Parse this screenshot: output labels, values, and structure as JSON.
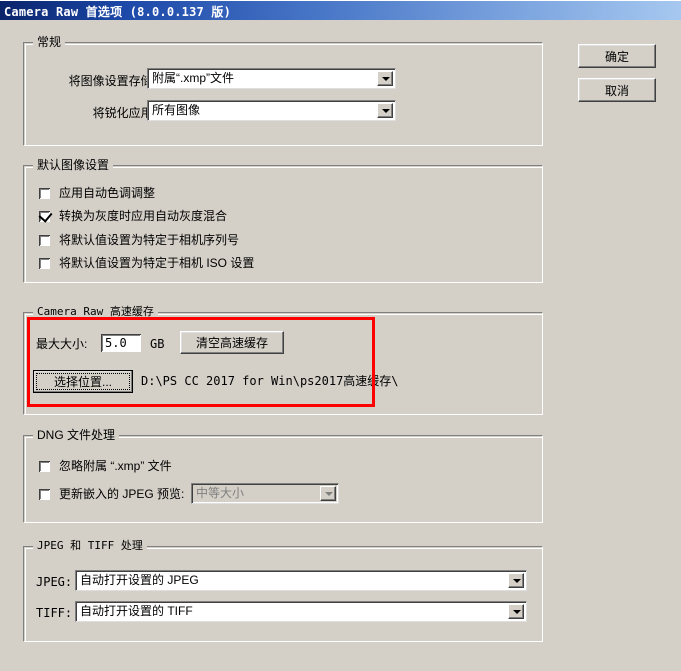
{
  "window": {
    "title": "Camera Raw 首选项  (8.0.0.137 版)"
  },
  "action_buttons": {
    "ok_label": "确定",
    "cancel_label": "取消"
  },
  "groups": {
    "general": {
      "title": "常规",
      "save_settings_label": "将图像设置存储在:",
      "save_settings_value": "附属“.xmp”文件",
      "apply_sharpening_label": "将锐化应用于:",
      "apply_sharpening_value": "所有图像"
    },
    "default_image_settings": {
      "title": "默认图像设置",
      "items": [
        {
          "label": "应用自动色调调整",
          "checked": false
        },
        {
          "label": "转换为灰度时应用自动灰度混合",
          "checked": true
        },
        {
          "label": "将默认值设置为特定于相机序列号",
          "checked": false
        },
        {
          "label": "将默认值设置为特定于相机 ISO 设置",
          "checked": false
        }
      ]
    },
    "camera_raw_cache": {
      "title": "Camera Raw 高速缓存",
      "max_size_label": "最大大小:",
      "max_size_value": "5.0",
      "unit_label": "GB",
      "purge_button_label": "清空高速缓存",
      "select_location_button_label": "选择位置...",
      "location_path": "D:\\PS CC 2017 for Win\\ps2017高速缓存\\",
      "highlight_color": "#ff0000"
    },
    "dng_file_handling": {
      "title": "DNG 文件处理",
      "items": [
        {
          "label": "忽略附属 “.xmp” 文件",
          "checked": false
        },
        {
          "label": "更新嵌入的 JPEG 预览:",
          "checked": false
        }
      ],
      "jpeg_preview_value": "中等大小"
    },
    "jpeg_tiff_handling": {
      "title": "JPEG 和 TIFF 处理",
      "jpeg_label": "JPEG:",
      "jpeg_value": "自动打开设置的 JPEG",
      "tiff_label": "TIFF:",
      "tiff_value": "自动打开设置的 TIFF"
    }
  }
}
